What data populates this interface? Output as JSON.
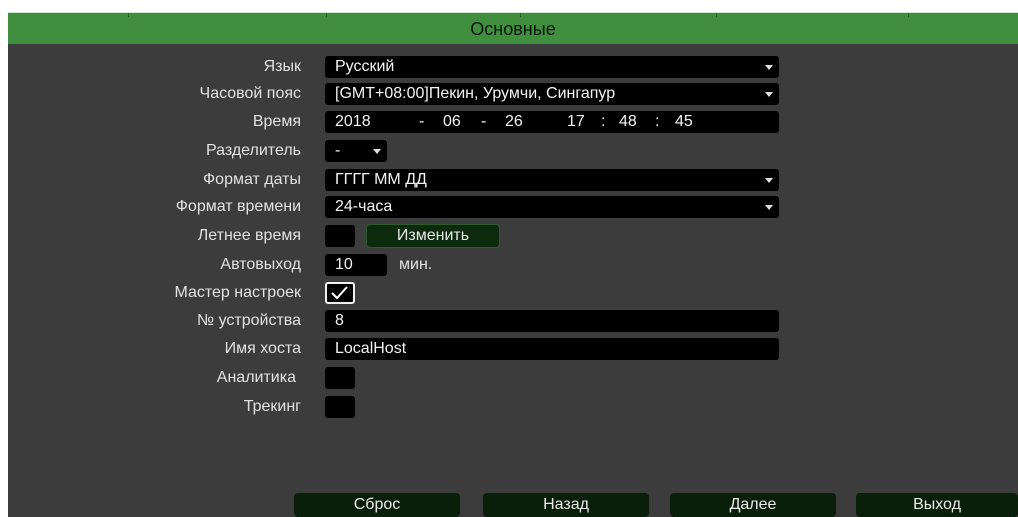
{
  "title": "Основные",
  "rows": {
    "language": {
      "label": "Язык",
      "value": "Русский"
    },
    "timezone": {
      "label": "Часовой пояс",
      "value": "[GMT+08:00]Пекин, Урумчи, Сингапур"
    },
    "time": {
      "label": "Время",
      "year": "2018",
      "sep1": "-",
      "month": "06",
      "sep2": "-",
      "day": "26",
      "hour": "17",
      "colon1": ":",
      "minute": "48",
      "colon2": ":",
      "second": "45"
    },
    "separator": {
      "label": "Разделитель",
      "value": "-"
    },
    "date_format": {
      "label": "Формат даты",
      "value": "ГГГГ ММ ДД"
    },
    "time_format": {
      "label": "Формат времени",
      "value": "24-часа"
    },
    "dst": {
      "label": "Летнее время",
      "button": "Изменить"
    },
    "autologout": {
      "label": "Автовыход",
      "value": "10",
      "unit": "мин."
    },
    "wizard": {
      "label": "Мастер настроек",
      "checked": true
    },
    "device_no": {
      "label": "№ устройства",
      "value": "8"
    },
    "hostname": {
      "label": "Имя хоста",
      "value": "LocalHost"
    },
    "analytics": {
      "label": "Аналитика"
    },
    "tracking": {
      "label": "Трекинг"
    }
  },
  "footer": {
    "reset": "Сброс",
    "back": "Назад",
    "next": "Далее",
    "exit": "Выход"
  },
  "colors": {
    "title_bar": "#3f8f3e",
    "panel": "#3c3c3c",
    "field": "#000000",
    "button": "#0a1f0a"
  }
}
